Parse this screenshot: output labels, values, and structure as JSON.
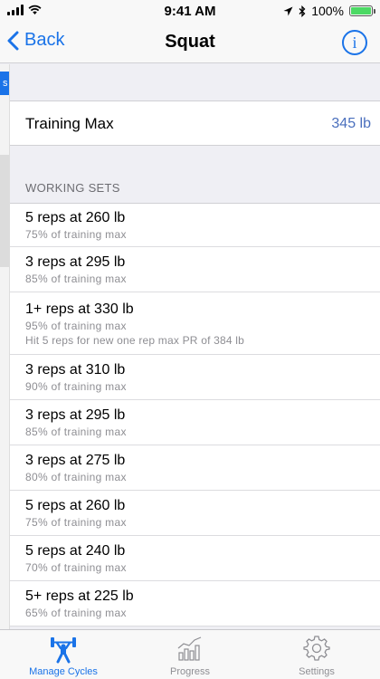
{
  "status": {
    "time": "9:41 AM",
    "battery": "100%"
  },
  "nav": {
    "back_label": "Back",
    "title": "Squat",
    "info_label": "i"
  },
  "training_max": {
    "label": "Training Max",
    "value": "345 lb"
  },
  "section": {
    "header": "WORKING SETS"
  },
  "sets": [
    {
      "title": "5 reps at 260 lb",
      "subtitle": "75% of training max"
    },
    {
      "title": "3 reps at 295 lb",
      "subtitle": "85% of training max"
    },
    {
      "title": "1+ reps at 330 lb",
      "subtitle": "95% of training max",
      "note": "Hit 5 reps for new one rep max PR of 384 lb"
    },
    {
      "title": "3 reps at 310 lb",
      "subtitle": "90% of training max"
    },
    {
      "title": "3 reps at 295 lb",
      "subtitle": "85% of training max"
    },
    {
      "title": "3 reps at 275 lb",
      "subtitle": "80% of training max"
    },
    {
      "title": "5 reps at 260 lb",
      "subtitle": "75% of training max"
    },
    {
      "title": "5 reps at 240 lb",
      "subtitle": "70% of training max"
    },
    {
      "title": "5+ reps at 225 lb",
      "subtitle": "65% of training max"
    }
  ],
  "tabs": [
    {
      "label": "Manage Cycles",
      "icon": "weightlifter-icon",
      "active": true
    },
    {
      "label": "Progress",
      "icon": "chart-icon",
      "active": false
    },
    {
      "label": "Settings",
      "icon": "gear-icon",
      "active": false
    }
  ],
  "colors": {
    "accent": "#1a73e8",
    "value_text": "#4a6fbd",
    "battery": "#4cd964"
  }
}
